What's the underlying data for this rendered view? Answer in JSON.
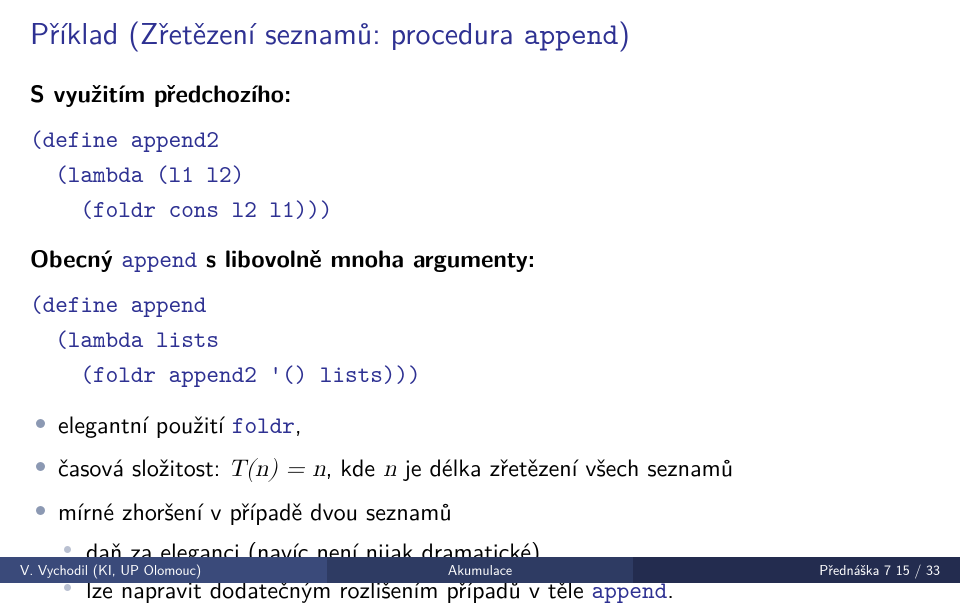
{
  "title_prefix": "Příklad (Zřetězení seznamů: procedura ",
  "title_code": "append",
  "title_suffix": ")",
  "sub1": "S využitím předchozího:",
  "code1_l1": "(define append2",
  "code1_l2": "  (lambda (l1 l2)",
  "code1_l3": "    (foldr cons l2 l1)))",
  "sub2_prefix": "Obecný ",
  "sub2_code": "append",
  "sub2_suffix": " s libovolně mnoha argumenty:",
  "code2_l1": "(define append",
  "code2_l2": "  (lambda lists",
  "code2_l3": "    (foldr append2 '() lists)))",
  "b1_prefix": "elegantní použití ",
  "b1_code": "foldr",
  "b1_suffix": ",",
  "b2_prefix": "časová složitost: ",
  "b2_math": "T(n) = n",
  "b2_mid": ", kde ",
  "b2_mathn": "n",
  "b2_suffix": " je délka zřetězení všech seznamů",
  "b3": "mírné zhoršení v případě dvou seznamů",
  "b3a": "daň za eleganci (navíc není nijak dramatické),",
  "b3b_prefix": "lze napravit dodatečným rozlišením případů v těle ",
  "b3b_code": "append",
  "b3b_suffix": ".",
  "footer_left": "V. Vychodil (KI, UP Olomouc)",
  "footer_mid": "Akumulace",
  "footer_right": "Přednáška 7     15 / 33"
}
